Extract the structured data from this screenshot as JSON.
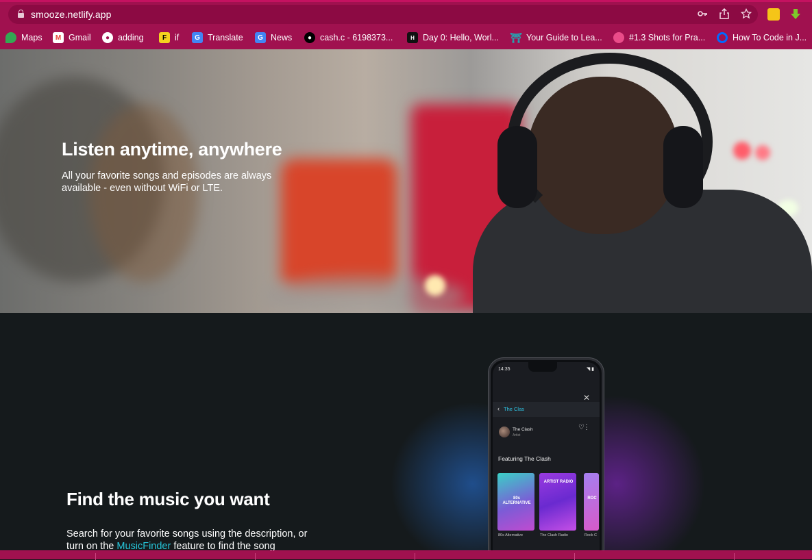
{
  "browser": {
    "url": "smooze.netlify.app",
    "bookmarks": [
      {
        "label": "Maps",
        "icon": "maps-icon",
        "color": "#34a853"
      },
      {
        "label": "Gmail",
        "icon": "gmail-icon",
        "color": "#ea4335"
      },
      {
        "label": "adding",
        "icon": "globe-icon",
        "color": "#ffffff"
      },
      {
        "label": "if",
        "icon": "f-icon",
        "color": "#f4d21f"
      },
      {
        "label": "Translate",
        "icon": "translate-icon",
        "color": "#4285f4"
      },
      {
        "label": "News",
        "icon": "news-icon",
        "color": "#4285f4"
      },
      {
        "label": "cash.c - 6198373...",
        "icon": "github-icon",
        "color": "#000000"
      },
      {
        "label": "Day 0: Hello, Worl...",
        "icon": "hackerrank-icon",
        "color": "#111111"
      },
      {
        "label": "Your Guide to Lea...",
        "icon": "torii-icon",
        "color": "#22a7b5"
      },
      {
        "label": "#1.3 Shots for Pra...",
        "icon": "dribbble-icon",
        "color": "#ea4c89"
      },
      {
        "label": "How To Code in J...",
        "icon": "do-icon",
        "color": "#0069ff"
      }
    ]
  },
  "hero": {
    "title": "Listen anytime, anywhere",
    "text": "All your favorite songs and episodes are always available - even without WiFi or LTE."
  },
  "feature": {
    "title": "Find the music you want",
    "text_before": "Search for your favorite songs using the description, or turn on the ",
    "link": "MusicFinder",
    "text_after": " feature to find the song"
  },
  "phone": {
    "time": "14:35",
    "search_query": "The Clas",
    "artist": "The Clash",
    "artist_sub": "Artist",
    "featuring": "Featuring The Clash",
    "cards": [
      {
        "label": "80s ALTERNATIVE",
        "caption": "80s Alternative"
      },
      {
        "label": "ARTIST RADIO",
        "caption": "The Clash Radio"
      },
      {
        "label": "ROC",
        "caption": "Rock C"
      }
    ]
  }
}
